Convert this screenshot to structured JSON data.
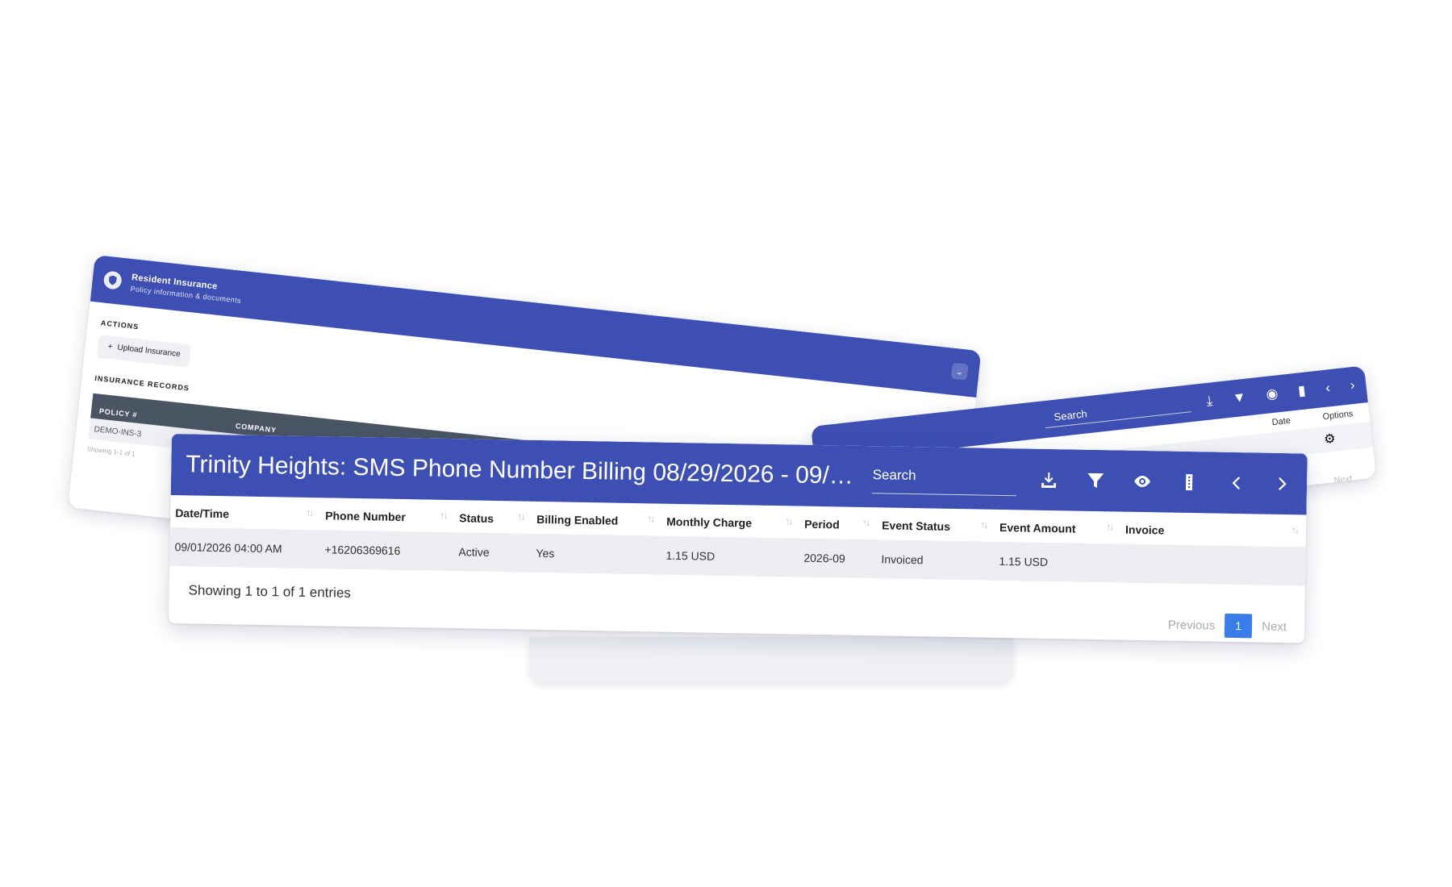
{
  "insurance_card": {
    "title": "Resident Insurance",
    "subtitle": "Policy information & documents",
    "actions_label": "ACTIONS",
    "upload_label": "Upload Insurance",
    "records_label": "INSURANCE RECORDS",
    "columns": [
      "POLICY #",
      "COMPANY"
    ],
    "row_policy": "DEMO-INS-3",
    "footer": "Showing 1-1 of 1"
  },
  "back_card": {
    "search_placeholder": "Search",
    "columns": [
      "Date",
      "Options"
    ],
    "next_label": "Next"
  },
  "main": {
    "title": "Trinity Heights: SMS Phone Number Billing 08/29/2026 - 09/09...",
    "search_placeholder": "Search",
    "columns": [
      "Date/Time",
      "Phone Number",
      "Status",
      "Billing Enabled",
      "Monthly Charge",
      "Period",
      "Event Status",
      "Event Amount",
      "Invoice"
    ],
    "rows": [
      {
        "datetime": "09/01/2026 04:00 AM",
        "phone": "+16206369616",
        "status": "Active",
        "billing_enabled": "Yes",
        "monthly_charge": "1.15 USD",
        "period": "2026-09",
        "event_status": "Invoiced",
        "event_amount": "1.15 USD",
        "invoice": ""
      }
    ],
    "showing": "Showing 1 to 1 of 1 entries",
    "pager": {
      "previous": "Previous",
      "page": "1",
      "next": "Next"
    }
  },
  "colors": {
    "header": "#3d4fb3",
    "page_active": "#3b7de8",
    "row_bg": "#eceef1"
  }
}
